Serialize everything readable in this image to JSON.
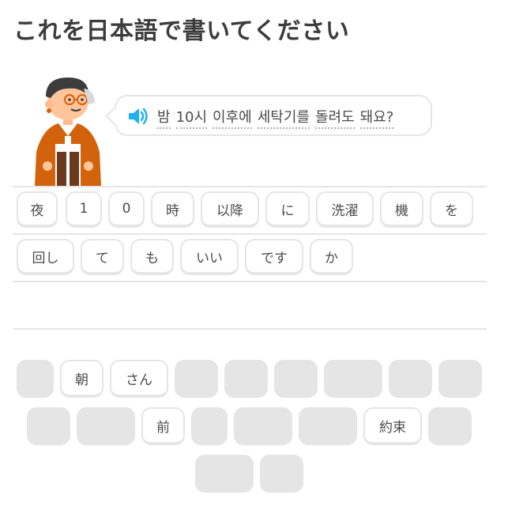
{
  "prompt": {
    "title": "これを日本語で書いてください"
  },
  "sentence": {
    "words": [
      "밤",
      "10시",
      "이후에",
      "세탁기를",
      "돌려도",
      "돼요?"
    ]
  },
  "answer": {
    "tiles": [
      "夜",
      "1",
      "0",
      "時",
      "以降",
      "に",
      "洗濯",
      "機",
      "を",
      "回し",
      "て",
      "も",
      "いい",
      "です",
      "か"
    ]
  },
  "bank": {
    "remaining": [
      "朝",
      "さん",
      "前",
      "約束"
    ]
  },
  "colors": {
    "speaker": "#1cb0f6",
    "character_jacket": "#d2620b",
    "tile_border": "#e5e5e5",
    "slot_fill": "#e5e5e5"
  }
}
